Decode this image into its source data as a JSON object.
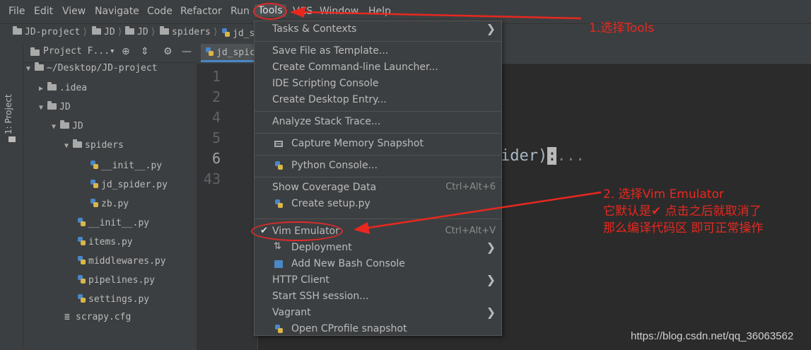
{
  "menubar": {
    "items": [
      "File",
      "Edit",
      "View",
      "Navigate",
      "Code",
      "Refactor",
      "Run",
      "Tools",
      "VCS",
      "Window",
      "Help"
    ],
    "active": "Tools"
  },
  "breadcrumbs": {
    "items": [
      "JD-project",
      "JD",
      "JD",
      "spiders",
      "jd_s"
    ]
  },
  "left_strip": {
    "label": "1: Project"
  },
  "project_panel": {
    "title": "Project F...▾",
    "tree": [
      {
        "label": "~/Desktop/JD-project",
        "kind": "folder",
        "expanded": true
      },
      {
        "label": ".idea",
        "kind": "folder",
        "expanded": false
      },
      {
        "label": "JD",
        "kind": "folder",
        "expanded": true
      },
      {
        "label": "JD",
        "kind": "folder",
        "expanded": true
      },
      {
        "label": "spiders",
        "kind": "folder",
        "expanded": true
      },
      {
        "label": "__init__.py",
        "kind": "python"
      },
      {
        "label": "jd_spider.py",
        "kind": "python"
      },
      {
        "label": "zb.py",
        "kind": "python"
      },
      {
        "label": "__init__.py",
        "kind": "python"
      },
      {
        "label": "items.py",
        "kind": "python"
      },
      {
        "label": "middlewares.py",
        "kind": "python"
      },
      {
        "label": "pipelines.py",
        "kind": "python"
      },
      {
        "label": "settings.py",
        "kind": "python"
      },
      {
        "label": "scrapy.cfg",
        "kind": "config"
      }
    ]
  },
  "editor": {
    "tab_label": "jd_spic",
    "line_numbers": [
      "1",
      "2",
      "4",
      "5",
      "6",
      "43"
    ],
    "code_fragment": "ider)",
    "cursor_char": ":",
    "fold_text": "..."
  },
  "tools_menu": {
    "items": [
      {
        "label": "Tasks & Contexts",
        "submenu": true
      },
      {
        "label": "Save File as Template..."
      },
      {
        "label": "Create Command-line Launcher..."
      },
      {
        "label": "IDE Scripting Console"
      },
      {
        "label": "Create Desktop Entry..."
      },
      {
        "label": "Analyze Stack Trace..."
      },
      {
        "label": "Capture Memory Snapshot",
        "icon": "memory-icon"
      },
      {
        "label": "Python Console...",
        "icon": "python-icon"
      },
      {
        "label": "Show Coverage Data",
        "shortcut": "Ctrl+Alt+6"
      },
      {
        "label": "Create setup.py",
        "icon": "python-icon"
      },
      {
        "label": "Vim Emulator",
        "shortcut": "Ctrl+Alt+V",
        "checked": true
      },
      {
        "label": "Deployment",
        "icon": "deployment-icon",
        "submenu": true
      },
      {
        "label": "Add New Bash Console",
        "icon": "terminal-icon"
      },
      {
        "label": "HTTP Client",
        "submenu": true
      },
      {
        "label": "Start SSH session..."
      },
      {
        "label": "Vagrant",
        "submenu": true
      },
      {
        "label": "Open CProfile snapshot",
        "icon": "python-icon"
      }
    ]
  },
  "annotations": {
    "step1": "1.选择Tools",
    "step2_line1": "2. 选择Vim Emulator",
    "step2_line2": "它默认是✔ 点击之后就取消了",
    "step2_line3": "那么编译代码区 即可正常操作"
  },
  "watermark": "https://blog.csdn.net/qq_36063562",
  "colors": {
    "annotation": "#e8281f",
    "menu_bg": "#3c3f41",
    "editor_bg": "#2b2b2b",
    "accent_tab": "#4a88c7"
  }
}
